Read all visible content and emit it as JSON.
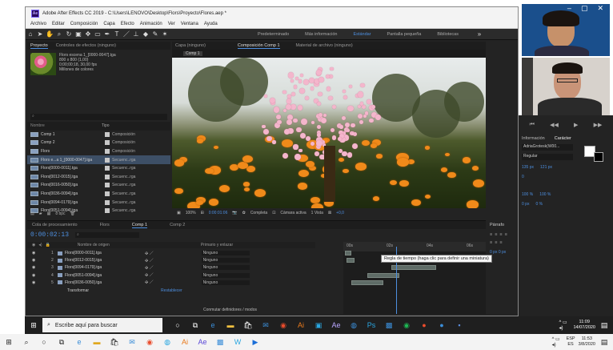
{
  "window": {
    "title": "Adobe After Effects CC 2019 - C:\\Users\\LENOVO\\Desktop\\Flors\\Proyecto\\Flores.aep *",
    "menu": [
      "Archivo",
      "Editar",
      "Composición",
      "Capa",
      "Efecto",
      "Animación",
      "Ver",
      "Ventana",
      "Ayuda"
    ]
  },
  "toolbar": {
    "workspaces": [
      "Predeterminado",
      "Más información",
      "Estándar",
      "Pantalla pequeña",
      "Bibliotecas"
    ],
    "active_workspace": "Estándar"
  },
  "project": {
    "tabs": [
      "Proyecto",
      "Controles de efectos (ninguno)"
    ],
    "selected_name": "Flors escena 1_[0000-0047].tga",
    "selected_info": [
      "800 x 800 (1,00)",
      "0;00;00;18, 30,00 fps",
      "Millones de colores"
    ],
    "columns": [
      "Nombre",
      "Tipo"
    ],
    "items": [
      {
        "name": "Comp 1",
        "type": "Composición",
        "kind": "comp"
      },
      {
        "name": "Comp 2",
        "type": "Composición",
        "kind": "comp"
      },
      {
        "name": "Flors",
        "type": "Composición",
        "kind": "comp"
      },
      {
        "name": "Flors e...a 1_[0000-0047].tga",
        "type": "Secuenc..rga",
        "kind": "seq",
        "selected": true
      },
      {
        "name": "Flors[0000-0011].tga",
        "type": "Secuenc..rga",
        "kind": "seq"
      },
      {
        "name": "Flors[0012-0015].tga",
        "type": "Secuenc..rga",
        "kind": "seq"
      },
      {
        "name": "Flors[0016-0050].tga",
        "type": "Secuenc..rga",
        "kind": "seq"
      },
      {
        "name": "Flors[0036-0094].tga",
        "type": "Secuenc..rga",
        "kind": "seq"
      },
      {
        "name": "Flors[0094-0179].tga",
        "type": "Secuenc..rga",
        "kind": "seq"
      },
      {
        "name": "Flors[0051-0094].tga",
        "type": "Secuenc..rga",
        "kind": "seq"
      }
    ],
    "footer_bpc": "8 bpc"
  },
  "viewer": {
    "tabs": [
      "Capa (ninguno)",
      "Composición Comp 1",
      "Material de archivo (ninguno)"
    ],
    "subtab": "Comp 1",
    "zoom": "100%",
    "timecode": "0:00:01:06",
    "resolution": "Completa",
    "camera": "Cámara activa",
    "views": "1 Vista",
    "exposure": "+0,0"
  },
  "character": {
    "tabs": [
      "Información",
      "Carácter"
    ],
    "font": "AdriaGrotesk(W00...",
    "style": "Regular",
    "size": "135 px",
    "leading": "121 px",
    "tracking": "0",
    "scale_v": "100 %",
    "scale_h": "100 %",
    "baseline": "0 px",
    "tsume": "0 %"
  },
  "timeline": {
    "tabs": [
      "Cola de procesamiento",
      "Flors",
      "Comp 1",
      "Comp 2"
    ],
    "timecode": "0:00:02:13",
    "layer_header": [
      "Nombre de origen",
      "Primario y enlazar"
    ],
    "layers": [
      {
        "num": "1",
        "name": "Flors[0000-0011].tga",
        "parent": "Ninguno"
      },
      {
        "num": "2",
        "name": "Flors[0012-0015].tga",
        "parent": "Ninguno"
      },
      {
        "num": "3",
        "name": "Flors[0094-0179].tga",
        "parent": "Ninguno"
      },
      {
        "num": "4",
        "name": "Flors[0051-0094].tga",
        "parent": "Ninguno"
      },
      {
        "num": "5",
        "name": "Flors[0036-0050].tga",
        "parent": "Ninguno"
      }
    ],
    "transform_label": "Transformar",
    "reset_label": "Restablecer",
    "footer": "Conmutar definidores / modos",
    "ruler_ticks": [
      "00s",
      "02s",
      "04s",
      "06s"
    ],
    "tooltip": "Regla de tiempo (haga clic para definir una miniatura)"
  },
  "paragraph": {
    "title": "Párrafo",
    "indent_values": [
      "0 px",
      "0 px",
      "0 px",
      "0 px"
    ]
  },
  "taskbar": {
    "search_placeholder": "Escribe aquí para buscar",
    "time1": "11:09",
    "date1": "14/07/2020",
    "time2": "11:53",
    "date2": "3/8/2020",
    "lang1": "ESP",
    "lang2": "ES"
  }
}
